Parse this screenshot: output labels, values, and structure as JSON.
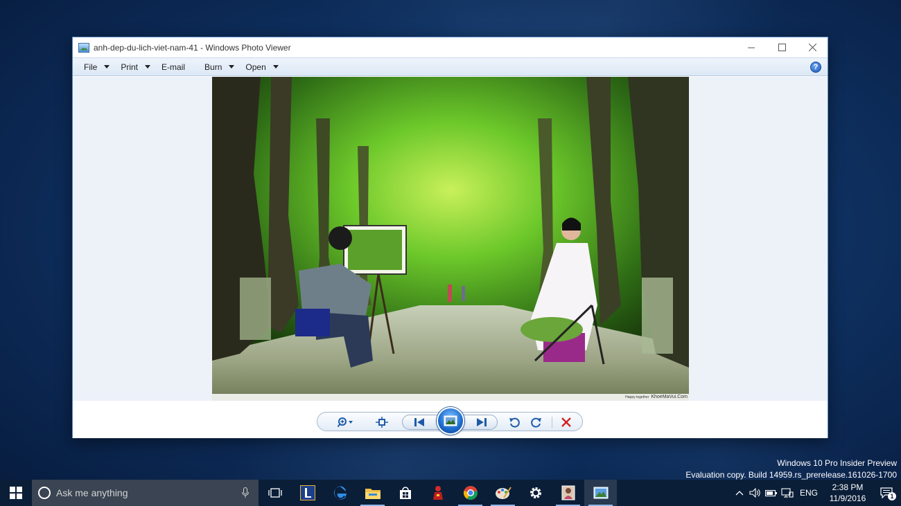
{
  "window": {
    "title": "anh-dep-du-lich-viet-nam-41 - Windows Photo Viewer",
    "controls": {
      "minimize": "minimize",
      "maximize": "maximize",
      "close": "close"
    }
  },
  "menu": {
    "items": [
      {
        "label": "File",
        "dropdown": true
      },
      {
        "label": "Print",
        "dropdown": true
      },
      {
        "label": "E-mail",
        "dropdown": false
      },
      {
        "label": "Burn",
        "dropdown": true
      },
      {
        "label": "Open",
        "dropdown": true
      }
    ],
    "help_label": "?"
  },
  "photo": {
    "credit_small": "Happy together",
    "credit": "KhoeMaVui.Com"
  },
  "watermark": {
    "line1": "Windows 10 Pro Insider Preview",
    "line2": "Evaluation copy. Build 14959.rs_prerelease.161026-1700"
  },
  "taskbar": {
    "search_placeholder": "Ask me anything",
    "apps": [
      "task-view-icon",
      "app-l-icon",
      "edge-icon",
      "file-explorer-icon",
      "store-icon",
      "red-figure-app-icon",
      "chrome-icon",
      "paint-icon",
      "settings-icon",
      "photo-frame-app-icon",
      "photo-viewer-icon"
    ],
    "language": "ENG",
    "time": "2:38 PM",
    "date": "11/9/2016",
    "notification_count": "1"
  },
  "colors": {
    "accent": "#1d5aa8",
    "taskbar": "#0b1e38",
    "desktop": "#0f3263"
  }
}
